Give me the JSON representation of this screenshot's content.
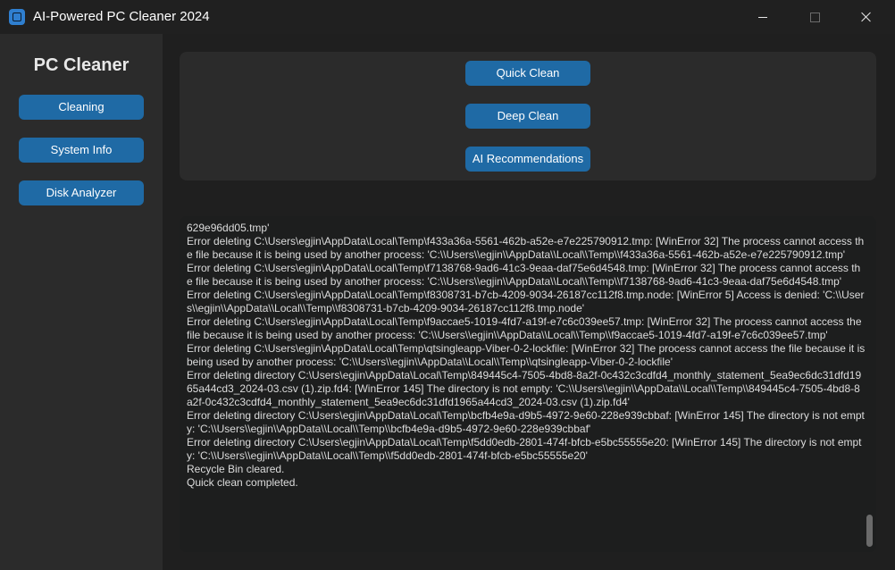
{
  "window": {
    "title": "AI-Powered PC Cleaner 2024"
  },
  "sidebar": {
    "title": "PC Cleaner",
    "items": [
      {
        "label": "Cleaning"
      },
      {
        "label": "System Info"
      },
      {
        "label": "Disk Analyzer"
      }
    ]
  },
  "actions": {
    "quick_clean": "Quick Clean",
    "deep_clean": "Deep Clean",
    "ai_recommendations": "AI Recommendations"
  },
  "log": {
    "text": "629e96dd05.tmp'\nError deleting C:\\Users\\egjin\\AppData\\Local\\Temp\\f433a36a-5561-462b-a52e-e7e225790912.tmp: [WinError 32] The process cannot access the file because it is being used by another process: 'C:\\\\Users\\\\egjin\\\\AppData\\\\Local\\\\Temp\\\\f433a36a-5561-462b-a52e-e7e225790912.tmp'\nError deleting C:\\Users\\egjin\\AppData\\Local\\Temp\\f7138768-9ad6-41c3-9eaa-daf75e6d4548.tmp: [WinError 32] The process cannot access the file because it is being used by another process: 'C:\\\\Users\\\\egjin\\\\AppData\\\\Local\\\\Temp\\\\f7138768-9ad6-41c3-9eaa-daf75e6d4548.tmp'\nError deleting C:\\Users\\egjin\\AppData\\Local\\Temp\\f8308731-b7cb-4209-9034-26187cc112f8.tmp.node: [WinError 5] Access is denied: 'C:\\\\Users\\\\egjin\\\\AppData\\\\Local\\\\Temp\\\\f8308731-b7cb-4209-9034-26187cc112f8.tmp.node'\nError deleting C:\\Users\\egjin\\AppData\\Local\\Temp\\f9accae5-1019-4fd7-a19f-e7c6c039ee57.tmp: [WinError 32] The process cannot access the file because it is being used by another process: 'C:\\\\Users\\\\egjin\\\\AppData\\\\Local\\\\Temp\\\\f9accae5-1019-4fd7-a19f-e7c6c039ee57.tmp'\nError deleting C:\\Users\\egjin\\AppData\\Local\\Temp\\qtsingleapp-Viber-0-2-lockfile: [WinError 32] The process cannot access the file because it is being used by another process: 'C:\\\\Users\\\\egjin\\\\AppData\\\\Local\\\\Temp\\\\qtsingleapp-Viber-0-2-lockfile'\nError deleting directory C:\\Users\\egjin\\AppData\\Local\\Temp\\849445c4-7505-4bd8-8a2f-0c432c3cdfd4_monthly_statement_5ea9ec6dc31dfd1965a44cd3_2024-03.csv (1).zip.fd4: [WinError 145] The directory is not empty: 'C:\\\\Users\\\\egjin\\\\AppData\\\\Local\\\\Temp\\\\849445c4-7505-4bd8-8a2f-0c432c3cdfd4_monthly_statement_5ea9ec6dc31dfd1965a44cd3_2024-03.csv (1).zip.fd4'\nError deleting directory C:\\Users\\egjin\\AppData\\Local\\Temp\\bcfb4e9a-d9b5-4972-9e60-228e939cbbaf: [WinError 145] The directory is not empty: 'C:\\\\Users\\\\egjin\\\\AppData\\\\Local\\\\Temp\\\\bcfb4e9a-d9b5-4972-9e60-228e939cbbaf'\nError deleting directory C:\\Users\\egjin\\AppData\\Local\\Temp\\f5dd0edb-2801-474f-bfcb-e5bc55555e20: [WinError 145] The directory is not empty: 'C:\\\\Users\\\\egjin\\\\AppData\\\\Local\\\\Temp\\\\f5dd0edb-2801-474f-bfcb-e5bc55555e20'\nRecycle Bin cleared.\nQuick clean completed."
  },
  "colors": {
    "accent": "#1f6aa5",
    "background": "#1f1f1f",
    "panel": "#2b2b2b",
    "log_background": "#1d1e1e"
  }
}
